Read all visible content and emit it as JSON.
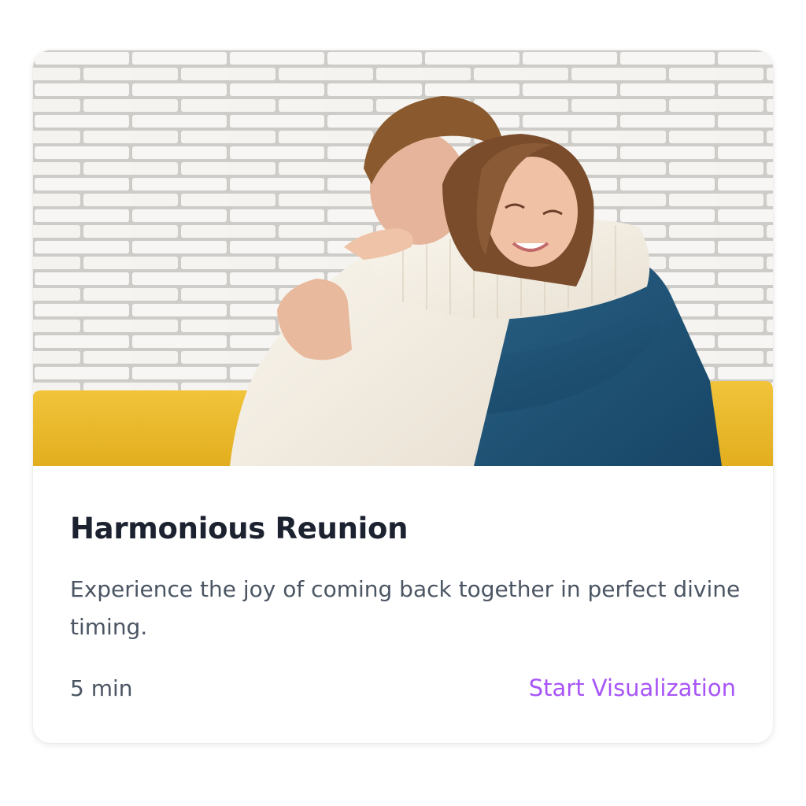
{
  "card": {
    "title": "Harmonious Reunion",
    "description": "Experience the joy of coming back together in perfect divine timing.",
    "duration": "5 min",
    "cta_label": "Start Visualization"
  },
  "colors": {
    "accent": "#a855f7",
    "title": "#1c2230",
    "body_text": "#4b5563"
  }
}
